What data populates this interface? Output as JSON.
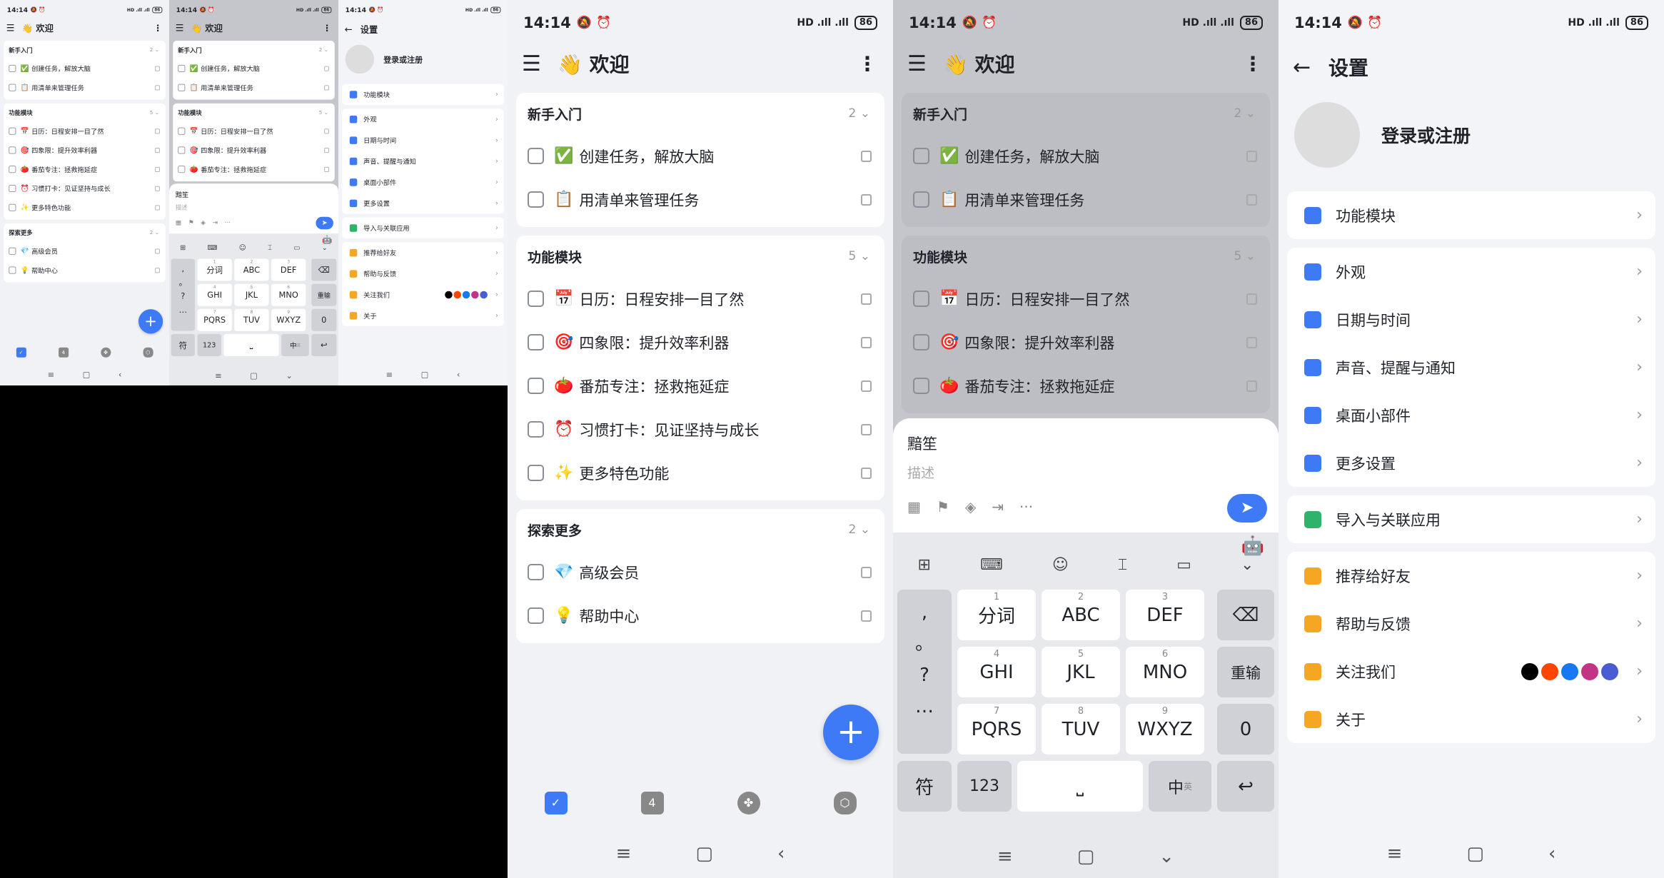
{
  "status": {
    "time": "14:14",
    "icons": "🔕 ⏰",
    "signal": "HD .ıll .ıll",
    "battery": "86"
  },
  "home": {
    "title": "👋 欢迎",
    "sections": [
      {
        "title": "新手入门",
        "count": "2",
        "tasks": [
          {
            "emoji": "✅",
            "text": "创建任务，解放大脑"
          },
          {
            "emoji": "📋",
            "text": "用清单来管理任务"
          }
        ]
      },
      {
        "title": "功能模块",
        "count": "5",
        "tasks": [
          {
            "emoji": "📅",
            "text": "日历：日程安排一目了然"
          },
          {
            "emoji": "🎯",
            "text": "四象限：提升效率利器"
          },
          {
            "emoji": "🍅",
            "text": "番茄专注：拯救拖延症"
          },
          {
            "emoji": "⏰",
            "text": "习惯打卡：见证坚持与成长"
          },
          {
            "emoji": "✨",
            "text": "更多特色功能"
          }
        ]
      },
      {
        "title": "探索更多",
        "count": "2",
        "tasks": [
          {
            "emoji": "💎",
            "text": "高级会员"
          },
          {
            "emoji": "💡",
            "text": "帮助中心"
          }
        ]
      }
    ],
    "fab": "+",
    "tab_calendar_day": "4"
  },
  "composer": {
    "title": "黯笙",
    "desc_placeholder": "描述",
    "send": "➤"
  },
  "keyboard": {
    "row1": [
      {
        "n": "1",
        "k": "分词"
      },
      {
        "n": "2",
        "k": "ABC"
      },
      {
        "n": "3",
        "k": "DEF"
      }
    ],
    "row2": [
      {
        "n": "4",
        "k": "GHI"
      },
      {
        "n": "5",
        "k": "JKL"
      },
      {
        "n": "6",
        "k": "MNO"
      }
    ],
    "row3": [
      {
        "n": "7",
        "k": "PQRS"
      },
      {
        "n": "8",
        "k": "TUV"
      },
      {
        "n": "9",
        "k": "WXYZ"
      }
    ],
    "side": [
      ",",
      "。",
      "?",
      "…"
    ],
    "delete": "⌫",
    "reinput": "重输",
    "zero": "0",
    "sym": "符",
    "num": "123",
    "lang": "中",
    "lang_sub": "英",
    "enter": "↩"
  },
  "settings": {
    "title": "设置",
    "login": "登录或注册",
    "groups": [
      [
        {
          "label": "功能模块",
          "color": "#3f7af6"
        }
      ],
      [
        {
          "label": "外观",
          "color": "#3f7af6"
        },
        {
          "label": "日期与时间",
          "color": "#3f7af6"
        },
        {
          "label": "声音、提醒与通知",
          "color": "#3f7af6"
        },
        {
          "label": "桌面小部件",
          "color": "#3f7af6"
        },
        {
          "label": "更多设置",
          "color": "#3f7af6"
        }
      ],
      [
        {
          "label": "导入与关联应用",
          "color": "#2fb36b"
        }
      ],
      [
        {
          "label": "推荐给好友",
          "color": "#f5a623"
        },
        {
          "label": "帮助与反馈",
          "color": "#f5a623"
        },
        {
          "label": "关注我们",
          "color": "#f5a623"
        },
        {
          "label": "关于",
          "color": "#f5a623"
        }
      ]
    ],
    "social": [
      "#000000",
      "#ff4500",
      "#1877f2",
      "#c13584",
      "#4a5cd1"
    ]
  }
}
